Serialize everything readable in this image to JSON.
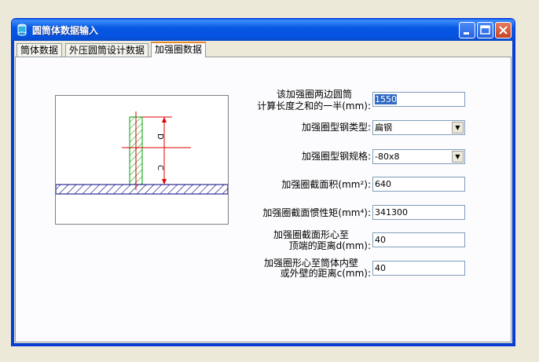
{
  "window": {
    "title": "圆筒体数据输入"
  },
  "tabs": [
    {
      "label": "筒体数据"
    },
    {
      "label": "外压圆筒设计数据"
    },
    {
      "label": "加强圈数据"
    }
  ],
  "diagram": {
    "label_D": "D",
    "label_C": "C"
  },
  "form": {
    "half_length_label_1": "该加强圈两边圆筒",
    "half_length_label_2": "计算长度之和的一半(mm):",
    "half_length_value": "1550",
    "steel_type_label": "加强圈型钢类型:",
    "steel_type_value": "扁钢",
    "steel_spec_label": "加强圈型钢规格:",
    "steel_spec_value": "-80x8",
    "area_label": "加强圈截面积(mm²):",
    "area_value": "640",
    "inertia_label": "加强圈截面惯性矩(mm⁴):",
    "inertia_value": "341300",
    "centroid_top_label_1": "加强圈截面形心至",
    "centroid_top_label_2": "顶端的距离d(mm):",
    "centroid_top_value": "40",
    "centroid_wall_label_1": "加强圈形心至筒体内壁",
    "centroid_wall_label_2": "或外壁的距离c(mm):",
    "centroid_wall_value": "40"
  },
  "colors": {
    "titlebar": "#0553e0",
    "active_tab_accent": "#e68b2c",
    "dimension_line": "#e00000",
    "ring_hatch": "#00a000",
    "shell_hatch": "#000080"
  }
}
